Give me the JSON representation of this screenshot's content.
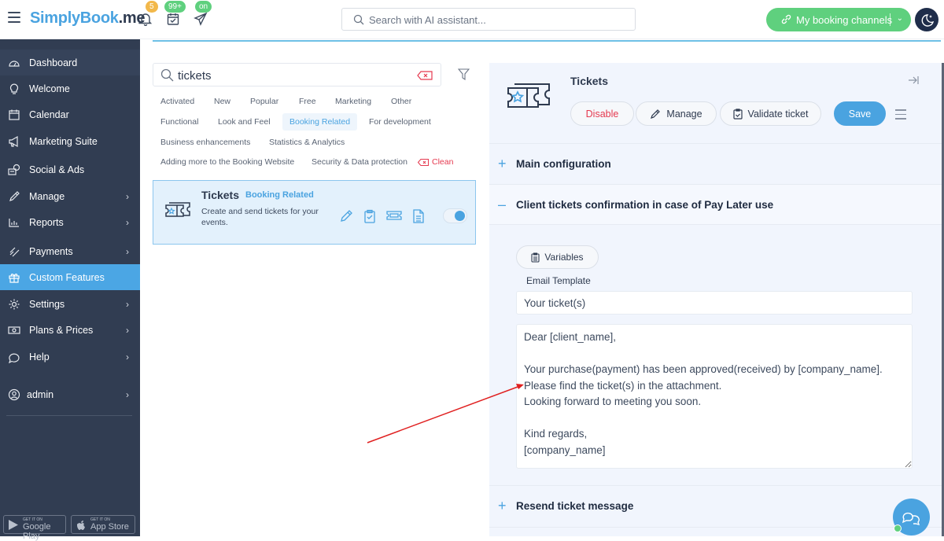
{
  "topbar": {
    "logo_prefix": "SimplyBook",
    "logo_suffix": ".me",
    "notifications_badge": "5",
    "bookings_badge": "99+",
    "publish_badge": "on",
    "search_placeholder": "Search with AI assistant...",
    "channels_label": "My booking channels",
    "colors": {
      "brand": "#4aa3e0",
      "green": "#5fd07e",
      "badge_orange": "#f2b84b"
    }
  },
  "sidebar": {
    "items": [
      {
        "label": "Dashboard",
        "icon": "dashboard-icon",
        "chevron": false
      },
      {
        "label": "Welcome",
        "icon": "lightbulb-icon",
        "chevron": false
      },
      {
        "label": "Calendar",
        "icon": "calendar-icon",
        "chevron": false
      },
      {
        "label": "Marketing Suite",
        "icon": "megaphone-icon",
        "chevron": false
      },
      {
        "label": "Social & Ads",
        "icon": "social-ads-icon",
        "chevron": false
      },
      {
        "label": "Manage",
        "icon": "pencil-icon",
        "chevron": true
      },
      {
        "label": "Reports",
        "icon": "bar-chart-icon",
        "chevron": true
      },
      {
        "label": "Payments",
        "icon": "payments-icon",
        "chevron": true
      },
      {
        "label": "Custom Features",
        "icon": "gift-icon",
        "chevron": false,
        "active": true
      },
      {
        "label": "Settings",
        "icon": "gear-icon",
        "chevron": true
      },
      {
        "label": "Plans & Prices",
        "icon": "money-icon",
        "chevron": true
      },
      {
        "label": "Help",
        "icon": "chat-bubble-icon",
        "chevron": true
      }
    ],
    "user": {
      "label": "admin"
    },
    "stores": [
      {
        "small": "GET IT ON",
        "big": "Google Play"
      },
      {
        "small": "GET IT ON",
        "big": "App Store"
      }
    ]
  },
  "features": {
    "search_value": "tickets",
    "tags": [
      "Activated",
      "New",
      "Popular",
      "Free",
      "Marketing",
      "Other",
      "Functional",
      "Look and Feel",
      "Booking Related",
      "For development",
      "Business enhancements",
      "Statistics & Analytics",
      "Adding more to the Booking Website",
      "Security & Data protection"
    ],
    "selected_tag": "Booking Related",
    "clean_label": "Clean",
    "card": {
      "title": "Tickets",
      "category": "Booking Related",
      "description": "Create and send tickets for your events.",
      "enabled": true
    }
  },
  "panel": {
    "title": "Tickets",
    "buttons": {
      "disable": "Disable",
      "manage": "Manage",
      "validate": "Validate ticket",
      "save": "Save"
    },
    "sections": [
      {
        "label": "Main configuration",
        "expanded": false
      },
      {
        "label": "Client tickets confirmation in case of Pay Later use",
        "expanded": true
      },
      {
        "label": "Resend ticket message",
        "expanded": false
      }
    ],
    "variables_label": "Variables",
    "email_template_label": "Email Template",
    "subject_value": "Your ticket(s)",
    "body_value": "Dear [client_name],\n\nYour purchase(payment) has been approved(received) by [company_name].\nPlease find the ticket(s) in the attachment.\nLooking forward to meeting you soon.\n\nKind regards,\n[company_name]"
  }
}
